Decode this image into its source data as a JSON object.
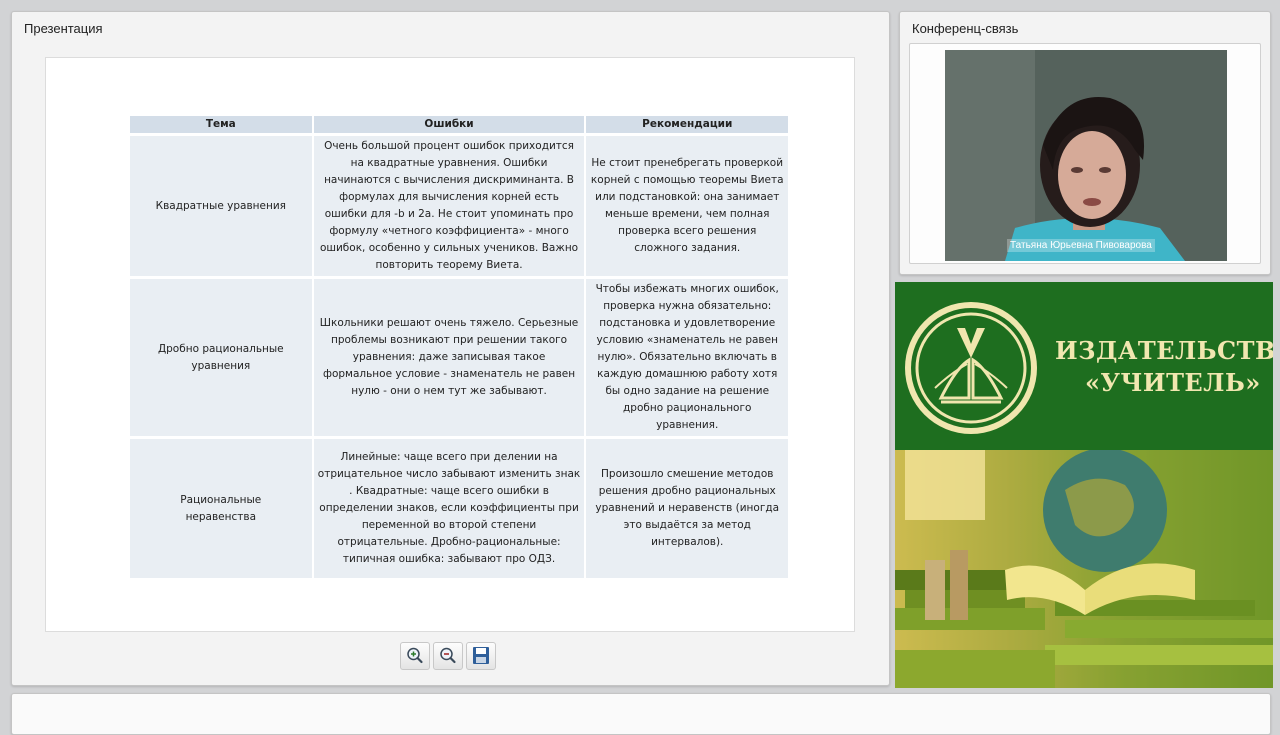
{
  "presentation": {
    "title": "Презентация",
    "table": {
      "headers": [
        "Тема",
        "Ошибки",
        "Рекомендации"
      ],
      "rows": [
        {
          "topic": "Квадратные уравнения",
          "errors": "Очень большой процент ошибок приходится на квадратные уравнения. Ошибки начинаются с вычисления дискриминанта. В формулах для вычисления корней есть ошибки для -b и 2a. Не стоит упоминать про формулу «четного коэффициента» - много ошибок, особенно у сильных учеников. Важно повторить теорему Виета.",
          "recommendations": "Не стоит пренебрегать проверкой корней с помощью теоремы Виета или подстановкой: она занимает меньше времени, чем полная проверка всего решения сложного задания."
        },
        {
          "topic": "Дробно рациональные уравнения",
          "errors": "Школьники решают очень тяжело. Серьезные проблемы возникают при решении такого уравнения: даже записывая такое формальное условие - знаменатель не равен нулю - они о нем тут же забывают.",
          "recommendations": "Чтобы избежать многих ошибок, проверка нужна обязательно: подстановка и удовлетворение условию «знаменатель не равен нулю». Обязательно включать в каждую домашнюю работу хотя бы одно задание на решение дробно рационального уравнения."
        },
        {
          "topic": "Рациональные неравенства",
          "errors": "Линейные: чаще всего при делении на отрицательное число забывают изменить знак . Квадратные: чаще всего ошибки в определении знаков, если коэффициенты при переменной во второй степени отрицательные. Дробно-рациональные: типичная ошибка: забывают про ОДЗ.",
          "recommendations": "Произошло смешение методов решения дробно рациональных уравнений и неравенств (иногда это выдаётся за метод интервалов)."
        }
      ]
    },
    "toolbar": {
      "zoom_in_icon": "zoom-in-icon",
      "zoom_out_icon": "zoom-out-icon",
      "save_icon": "save-icon"
    }
  },
  "conference": {
    "title": "Конференц-связь",
    "speaker_name": "Татьяна Юрьевна Пивоварова"
  },
  "ad": {
    "line1": "ИЗДАТЕЛЬСТВО",
    "line2": "«УЧИТЕЛЬ»"
  }
}
